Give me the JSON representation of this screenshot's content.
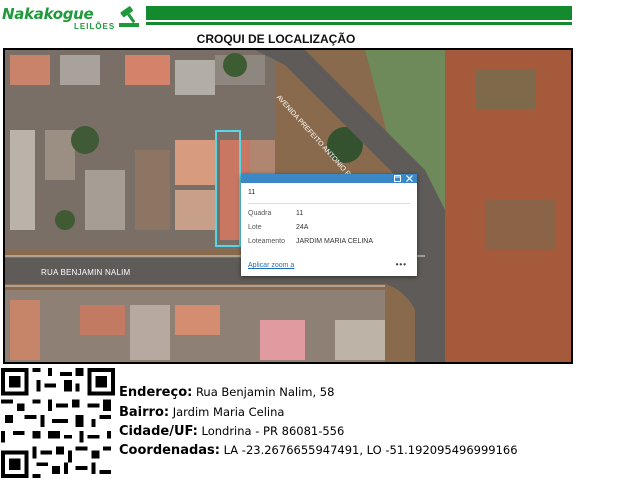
{
  "header": {
    "brand_name": "Nakakogue",
    "brand_sub": "LEILÕES",
    "page_title": "CROQUI DE LOCALIZAÇÃO"
  },
  "map": {
    "street_label": "RUA BENJAMIN NALIM",
    "avenue_label": "AVENIDA PREFEITO ANTONIO RIBAS DE ANDRADE",
    "parcel_highlight_color": "#56d6e6",
    "popup": {
      "title": "11",
      "fields": [
        {
          "label": "Quadra",
          "value": "11"
        },
        {
          "label": "Lote",
          "value": "24A"
        },
        {
          "label": "Loteamento",
          "value": "JARDIM MARIA CELINA"
        }
      ],
      "zoom_link": "Aplicar zoom a",
      "more_icon": "•••",
      "header_color": "#3b88c7"
    }
  },
  "address": {
    "endereco_label": "Endereço:",
    "endereco_value": "Rua Benjamin Nalim, 58",
    "bairro_label": "Bairro:",
    "bairro_value": "Jardim Maria Celina",
    "cidade_label": "Cidade/UF:",
    "cidade_value": "Londrina - PR 86081-556",
    "coord_label": "Coordenadas:",
    "coord_value": "LA -23.2676655947491, LO -51.192095496999166"
  },
  "colors": {
    "brand_green": "#138a2e"
  }
}
